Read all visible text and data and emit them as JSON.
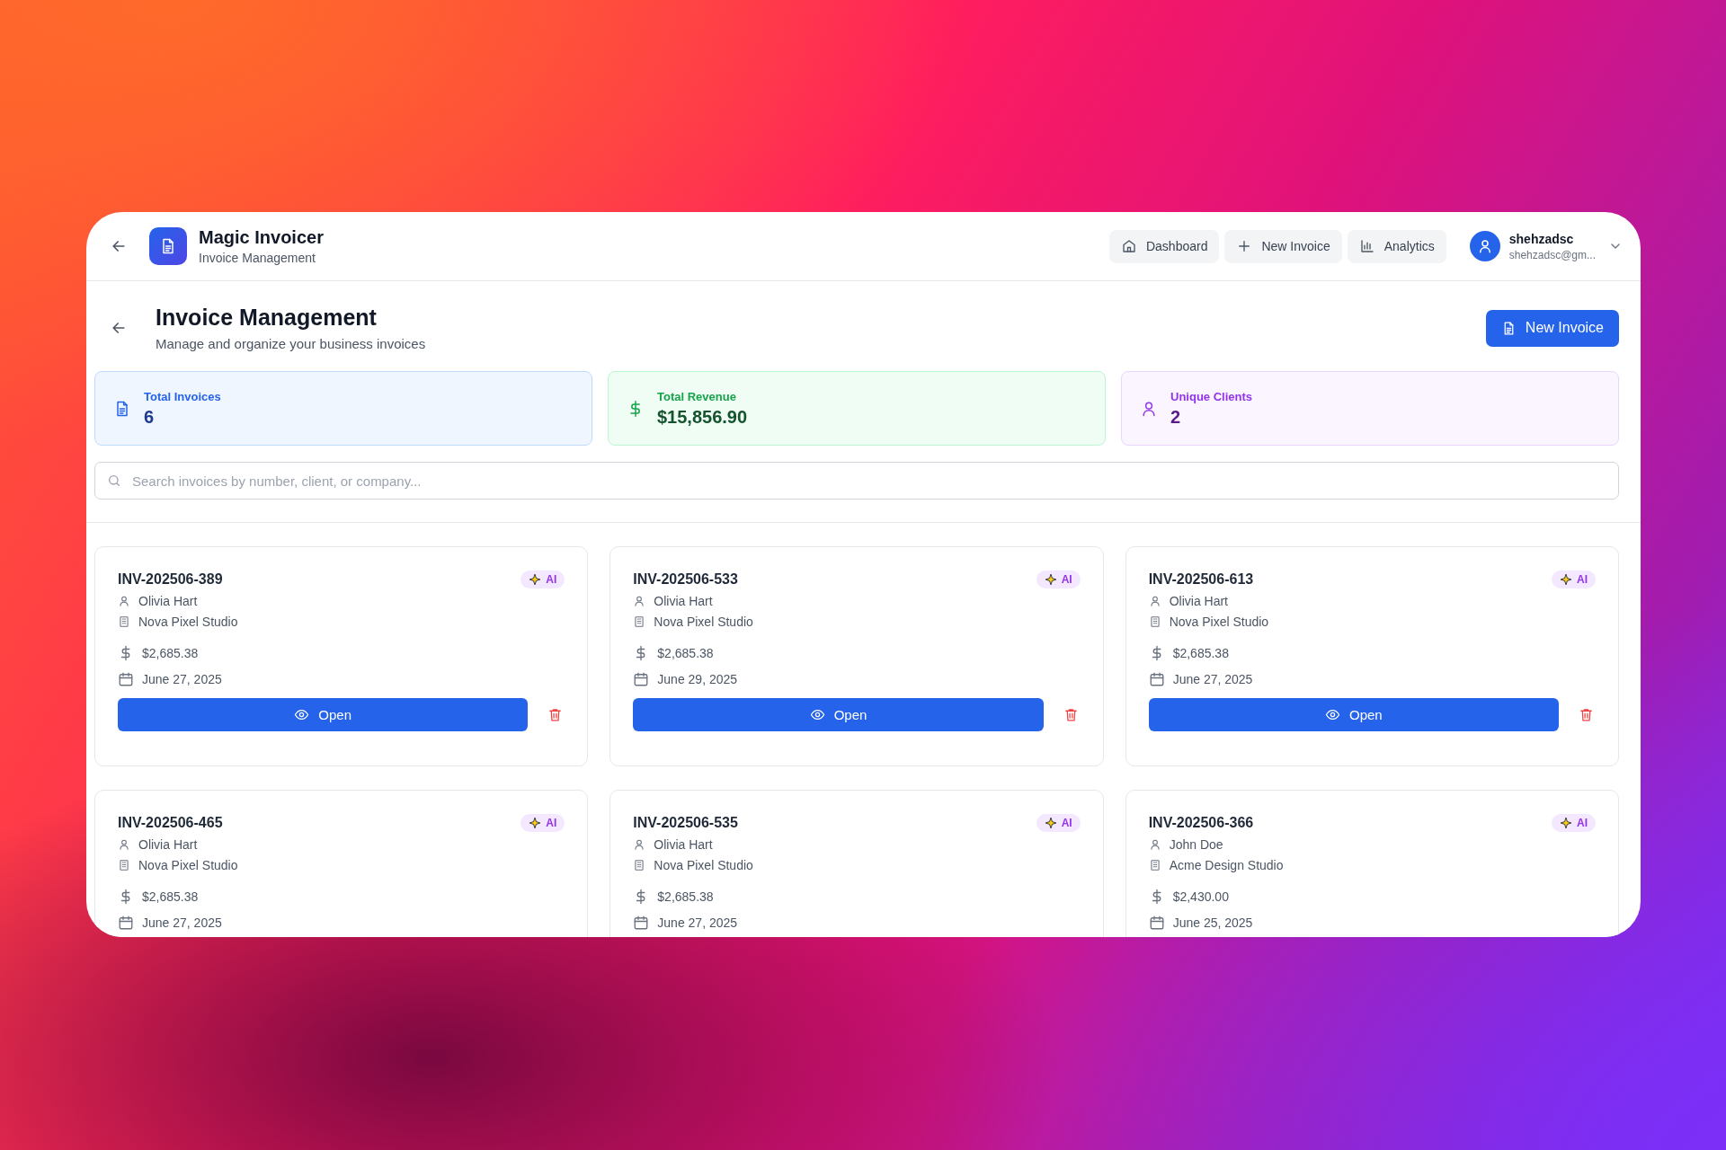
{
  "app": {
    "title": "Magic Invoicer",
    "subtitle": "Invoice Management"
  },
  "nav": [
    {
      "label": "Dashboard",
      "kind": "home"
    },
    {
      "label": "New Invoice",
      "kind": "plus"
    },
    {
      "label": "Analytics",
      "kind": "chart"
    }
  ],
  "user": {
    "name": "shehzadsc",
    "email": "shehzadsc@gm..."
  },
  "page": {
    "title": "Invoice Management",
    "subtitle": "Manage and organize your business invoices",
    "action": "New Invoice"
  },
  "stats": [
    {
      "label": "Total Invoices",
      "value": "6",
      "kind": "invoices"
    },
    {
      "label": "Total Revenue",
      "value": "$15,856.90",
      "kind": "revenue"
    },
    {
      "label": "Unique Clients",
      "value": "2",
      "kind": "clients"
    }
  ],
  "search": {
    "placeholder": "Search invoices by number, client, or company..."
  },
  "invoices": [
    {
      "number": "INV-202506-389",
      "badge": "AI",
      "client": "Olivia Hart",
      "company": "Nova Pixel Studio",
      "amount": "$2,685.38",
      "date": "June 27, 2025",
      "action": "Open"
    },
    {
      "number": "INV-202506-533",
      "badge": "AI",
      "client": "Olivia Hart",
      "company": "Nova Pixel Studio",
      "amount": "$2,685.38",
      "date": "June 29, 2025",
      "action": "Open"
    },
    {
      "number": "INV-202506-613",
      "badge": "AI",
      "client": "Olivia Hart",
      "company": "Nova Pixel Studio",
      "amount": "$2,685.38",
      "date": "June 27, 2025",
      "action": "Open"
    },
    {
      "number": "INV-202506-465",
      "badge": "AI",
      "client": "Olivia Hart",
      "company": "Nova Pixel Studio",
      "amount": "$2,685.38",
      "date": "June 27, 2025"
    },
    {
      "number": "INV-202506-535",
      "badge": "AI",
      "client": "Olivia Hart",
      "company": "Nova Pixel Studio",
      "amount": "$2,685.38",
      "date": "June 27, 2025"
    },
    {
      "number": "INV-202506-366",
      "badge": "AI",
      "client": "John Doe",
      "company": "Acme Design Studio",
      "amount": "$2,430.00",
      "date": "June 25, 2025"
    }
  ]
}
